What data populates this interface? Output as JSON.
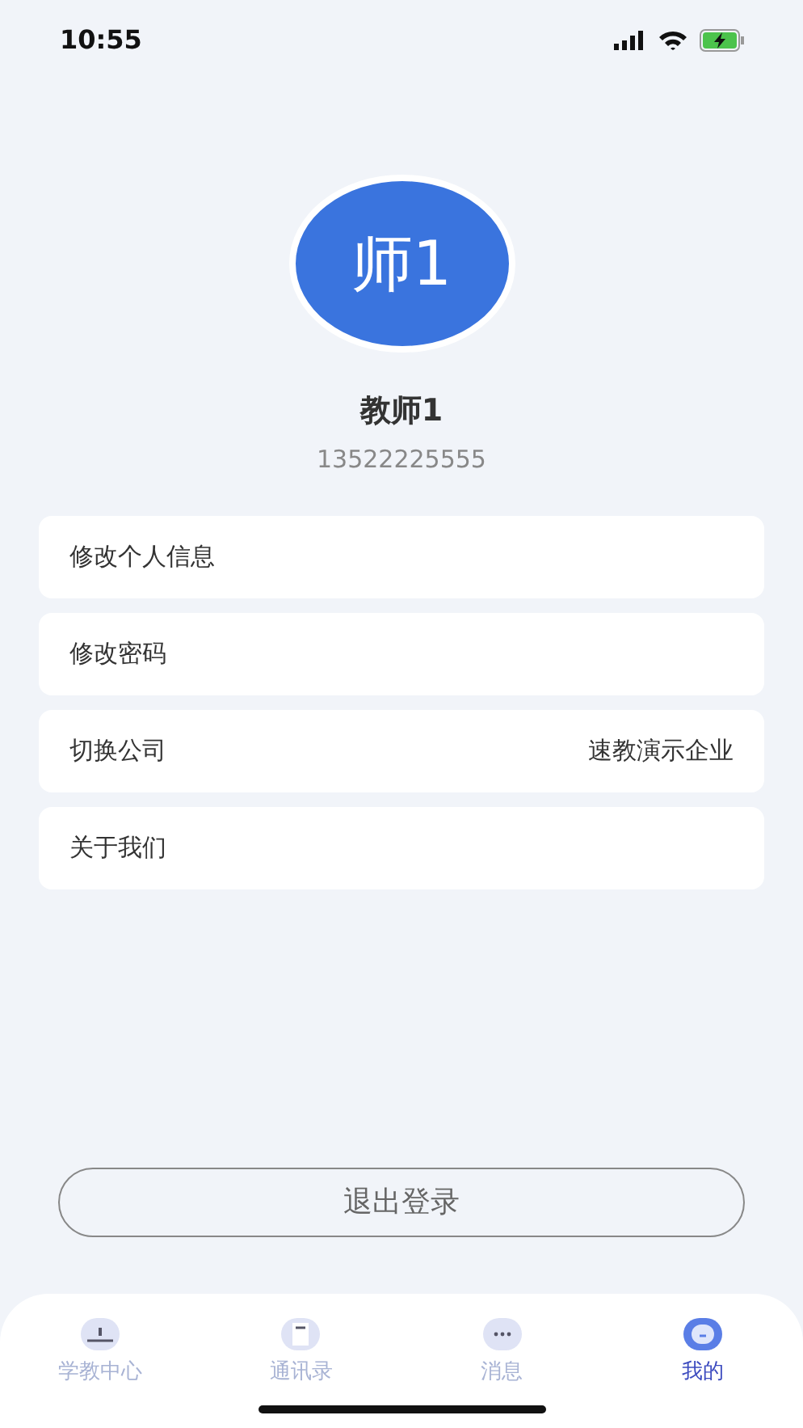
{
  "status_bar": {
    "time": "10:55"
  },
  "profile": {
    "avatar_text": "师1",
    "name": "教师1",
    "phone": "13522225555"
  },
  "menu": [
    {
      "label": "修改个人信息"
    },
    {
      "label": "修改密码"
    },
    {
      "label": "切换公司",
      "value": "速教演示企业"
    },
    {
      "label": "关于我们"
    }
  ],
  "logout_button": "退出登录",
  "tab_bar": [
    {
      "label": "学教中心",
      "selected": false
    },
    {
      "label": "通讯录",
      "selected": false
    },
    {
      "label": "消息",
      "selected": false
    },
    {
      "label": "我的",
      "selected": true
    }
  ]
}
